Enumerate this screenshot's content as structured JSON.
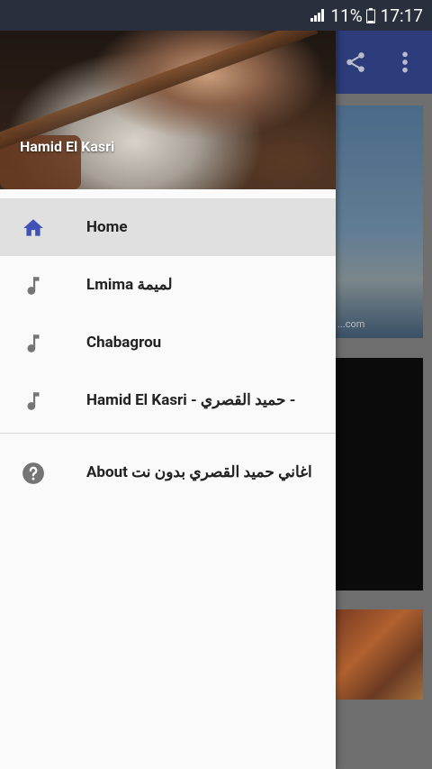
{
  "status_bar": {
    "battery_percent": "11%",
    "time": "17:17"
  },
  "drawer": {
    "header_title": "Hamid El Kasri",
    "items": [
      {
        "label": "Home",
        "icon": "home-icon",
        "selected": true
      },
      {
        "label": "Lmima لميمة",
        "icon": "music-note-icon",
        "selected": false
      },
      {
        "label": "Chabagrou",
        "icon": "music-note-icon",
        "selected": false
      },
      {
        "label": "Hamid El Kasri - حميد القصري -",
        "icon": "music-note-icon",
        "selected": false
      }
    ],
    "about": {
      "label": "About اغاني حميد القصري بدون نت",
      "icon": "help-icon"
    }
  },
  "background_app": {
    "card_watermark": "...com"
  },
  "colors": {
    "appbar": "#2d3c7a",
    "selected_icon": "#3f51b5",
    "icon_grey": "#757575"
  }
}
